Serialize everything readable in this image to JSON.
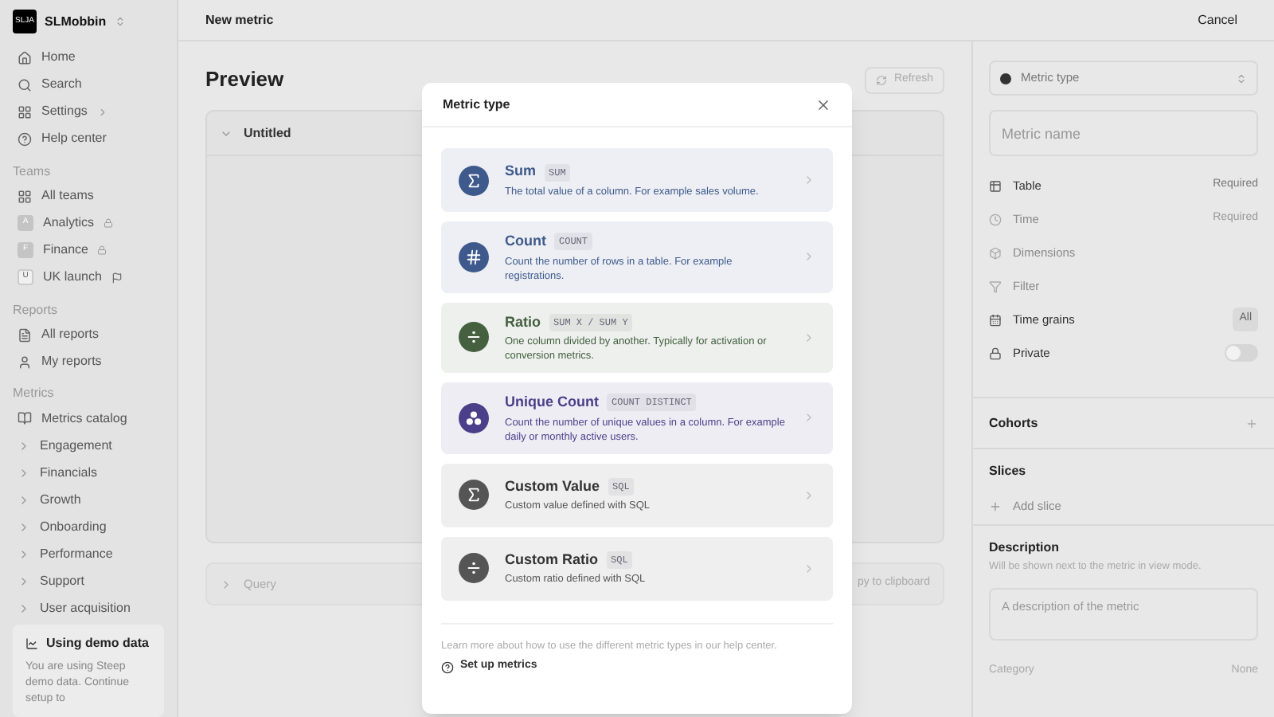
{
  "workspace": {
    "logo": "SLJA",
    "name": "SLMobbin"
  },
  "nav": [
    {
      "label": "Home",
      "has_chevron": false
    },
    {
      "label": "Search",
      "has_chevron": false
    },
    {
      "label": "Settings",
      "has_chevron": true
    },
    {
      "label": "Help center",
      "has_chevron": false
    }
  ],
  "teams": {
    "heading": "Teams",
    "items": [
      {
        "label": "All teams",
        "kind": "grid"
      },
      {
        "label": "Analytics",
        "kind": "locked",
        "letter": "A"
      },
      {
        "label": "Finance",
        "kind": "locked",
        "letter": "F"
      },
      {
        "label": "UK launch",
        "kind": "flagged",
        "letter": "U"
      }
    ]
  },
  "reports": {
    "heading": "Reports",
    "items": [
      {
        "label": "All reports"
      },
      {
        "label": "My reports"
      }
    ]
  },
  "metrics": {
    "heading": "Metrics",
    "catalog": "Metrics catalog",
    "groups": [
      {
        "label": "Engagement",
        "expanded": false
      },
      {
        "label": "Financials",
        "expanded": false
      },
      {
        "label": "Growth",
        "expanded": false
      },
      {
        "label": "Onboarding",
        "expanded": false
      },
      {
        "label": "Performance",
        "expanded": false
      },
      {
        "label": "Support",
        "expanded": false
      },
      {
        "label": "User acquisition",
        "expanded": false
      }
    ]
  },
  "demo_card": {
    "title": "Using demo data",
    "text": "You are using Steep demo data. Continue setup to"
  },
  "topbar": {
    "title": "New metric",
    "cancel": "Cancel"
  },
  "preview": {
    "title": "Preview",
    "refresh": "Refresh",
    "card_title": "Untitled",
    "card_expanded": true,
    "query_label": "Query",
    "query_expanded": false,
    "copy": "py to clipboard"
  },
  "panel": {
    "metric_type": "Metric type",
    "name_placeholder": "Metric name",
    "rows": [
      {
        "label": "Table",
        "kind": "value",
        "value": "Required",
        "disabled": false
      },
      {
        "label": "Time",
        "kind": "value",
        "value": "Required",
        "disabled": true
      },
      {
        "label": "Dimensions",
        "kind": "plain",
        "disabled": true
      },
      {
        "label": "Filter",
        "kind": "plain",
        "disabled": true
      },
      {
        "label": "Time grains",
        "kind": "badge",
        "value": "All",
        "disabled": false
      },
      {
        "label": "Private",
        "kind": "toggle",
        "on": false,
        "disabled": false
      }
    ],
    "cohorts": "Cohorts",
    "slices": "Slices",
    "add_slice": "Add slice",
    "description": "Description",
    "description_hint": "Will be shown next to the metric in view mode.",
    "description_placeholder": "A description of the metric",
    "category": "Category",
    "category_value": "None"
  },
  "modal": {
    "title": "Metric type",
    "types": [
      {
        "name": "Sum",
        "code": "SUM",
        "text": "The total value of a column. For example sales volume.",
        "kind": "sigma",
        "color": "#3e5a8c"
      },
      {
        "name": "Count",
        "code": "COUNT",
        "text": "Count the number of rows in a table. For example registrations.",
        "kind": "hash",
        "color": "#3e5a8c"
      },
      {
        "name": "Ratio",
        "code": "SUM X / SUM Y",
        "text": "One column divided by another. Typically for activation or conversion metrics.",
        "kind": "divide",
        "color": "#44603f"
      },
      {
        "name": "Unique Count",
        "code": "COUNT DISTINCT",
        "text": "Count the number of unique values in a column. For example daily or monthly active users.",
        "kind": "dots",
        "color": "#4c3f8a"
      },
      {
        "name": "Custom Value",
        "code": "SQL",
        "text": "Custom value defined with SQL",
        "kind": "sigma",
        "color": "#555555"
      },
      {
        "name": "Custom Ratio",
        "code": "SQL",
        "text": "Custom ratio defined with SQL",
        "kind": "divide",
        "color": "#555555"
      }
    ],
    "footer": "Learn more about how to use the different metric types in our help center.",
    "link": "Set up metrics"
  }
}
